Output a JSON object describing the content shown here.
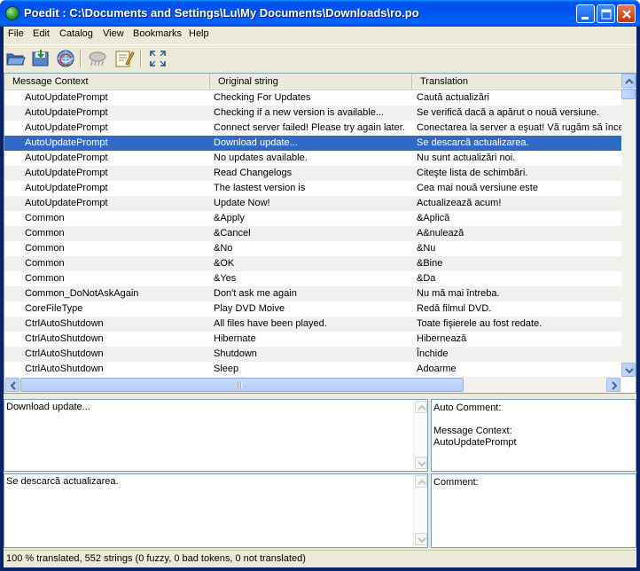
{
  "window": {
    "title": "Poedit : C:\\Documents and Settings\\Lu\\My Documents\\Downloads\\ro.po",
    "controls": [
      "minimize-icon",
      "maximize-icon",
      "close-icon"
    ]
  },
  "menu": {
    "items": [
      {
        "label": "File"
      },
      {
        "label": "Edit"
      },
      {
        "label": "Catalog"
      },
      {
        "label": "View"
      },
      {
        "label": "Bookmarks"
      },
      {
        "label": "Help"
      }
    ]
  },
  "toolbar": {
    "buttons": [
      "open-folder-icon",
      "save-icon",
      "update-catalog-icon",
      "validate-translations-icon",
      "edit-comment-icon",
      "fullscreen-icon"
    ]
  },
  "list": {
    "columns": [
      "Message Context",
      "Original string",
      "Translation"
    ],
    "selected_index": 3,
    "rows": [
      {
        "context": "AutoUpdatePrompt",
        "original": "Checking For Updates",
        "translation": "Caută actualizări"
      },
      {
        "context": "AutoUpdatePrompt",
        "original": "Checking if a new version is available...",
        "translation": "Se verifică dacă a apărut o nouă versiune."
      },
      {
        "context": "AutoUpdatePrompt",
        "original": "Connect server failed! Please try again later.",
        "translation": "Conectarea la server a eşuat! Vă rugăm să încercaţi mai târziu."
      },
      {
        "context": "AutoUpdatePrompt",
        "original": "Download update...",
        "translation": "Se descarcă actualizarea."
      },
      {
        "context": "AutoUpdatePrompt",
        "original": "No updates available.",
        "translation": "Nu sunt actualizări noi."
      },
      {
        "context": "AutoUpdatePrompt",
        "original": "Read Changelogs",
        "translation": "Citeşte lista de schimbări."
      },
      {
        "context": "AutoUpdatePrompt",
        "original": "The lastest version is",
        "translation": "Cea mai nouă versiune este"
      },
      {
        "context": "AutoUpdatePrompt",
        "original": "Update Now!",
        "translation": "Actualizează acum!"
      },
      {
        "context": "Common",
        "original": "&Apply",
        "translation": "&Aplică"
      },
      {
        "context": "Common",
        "original": "&Cancel",
        "translation": "A&nulează"
      },
      {
        "context": "Common",
        "original": "&No",
        "translation": "&Nu"
      },
      {
        "context": "Common",
        "original": "&OK",
        "translation": "&Bine"
      },
      {
        "context": "Common",
        "original": "&Yes",
        "translation": "&Da"
      },
      {
        "context": "Common_DoNotAskAgain",
        "original": "Don't ask me again",
        "translation": "Nu mă mai întreba."
      },
      {
        "context": "CoreFileType",
        "original": "Play DVD Moive",
        "translation": "Redă filmul DVD."
      },
      {
        "context": "CtrlAutoShutdown",
        "original": "All files have been played.",
        "translation": "Toate fişierele au fost redate."
      },
      {
        "context": "CtrlAutoShutdown",
        "original": "Hibernate",
        "translation": "Hibernează"
      },
      {
        "context": "CtrlAutoShutdown",
        "original": "Shutdown",
        "translation": "Închide"
      },
      {
        "context": "CtrlAutoShutdown",
        "original": "Sleep",
        "translation": "Adoarme"
      }
    ]
  },
  "editor": {
    "source_text": "Download update...",
    "translation_text": "Se descarcă actualizarea.",
    "auto_comment_label": "Auto Comment:",
    "context_label": "Message Context:",
    "context_value": "AutoUpdatePrompt",
    "comment_label": "Comment:"
  },
  "status": {
    "text": "100 % translated, 552 strings (0 fuzzy, 0 bad tokens, 0 not translated)"
  },
  "colors": {
    "selection": "#316ac5",
    "titlebar": "#0053ee",
    "face": "#ece9d8"
  }
}
